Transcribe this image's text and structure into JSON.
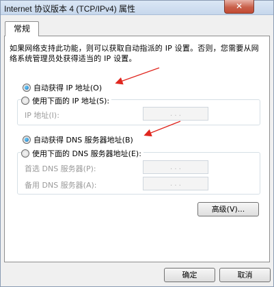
{
  "window": {
    "title": "Internet 协议版本 4 (TCP/IPv4) 属性",
    "close_label": "✕"
  },
  "tabs": [
    {
      "label": "常规",
      "selected": true
    }
  ],
  "description": "如果网络支持此功能，则可以获取自动指派的 IP 设置。否则，您需要从网络系统管理员处获得适当的 IP 设置。",
  "ip_section": {
    "auto_label": "自动获得 IP 地址(O)",
    "manual_label": "使用下面的 IP 地址(S):",
    "selected": "auto",
    "ip_field_label": "IP 地址(I):",
    "ip_value": ". . ."
  },
  "dns_section": {
    "auto_label": "自动获得 DNS 服务器地址(B)",
    "manual_label": "使用下面的 DNS 服务器地址(E):",
    "selected": "auto",
    "preferred_label": "首选 DNS 服务器(P):",
    "alternate_label": "备用 DNS 服务器(A):",
    "preferred_value": ". . .",
    "alternate_value": ". . ."
  },
  "buttons": {
    "advanced_label": "高级(V)...",
    "ok_label": "确定",
    "cancel_label": "取消"
  },
  "colors": {
    "annotation_arrow": "#e0271f",
    "radio_selected": "#1f6bb5"
  }
}
